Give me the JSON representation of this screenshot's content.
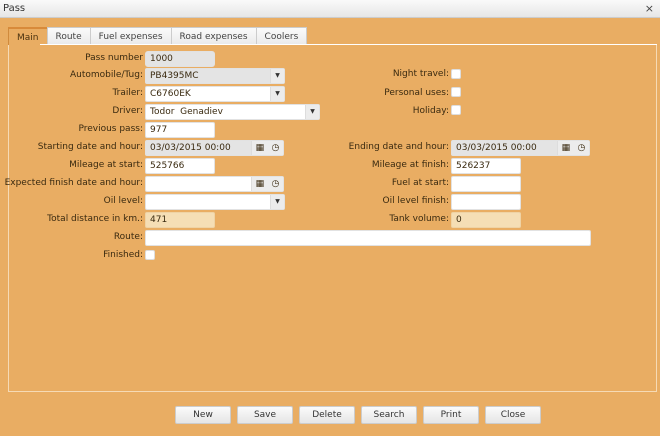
{
  "window": {
    "title": "Pass",
    "close": "×"
  },
  "tabs": [
    "Main",
    "Route",
    "Fuel expenses",
    "Road expenses",
    "Coolers"
  ],
  "left": {
    "pass_number": {
      "label": "Pass number",
      "value": "1000"
    },
    "automobile": {
      "label": "Automobile/Tug:",
      "value": "PB4395MC"
    },
    "trailer": {
      "label": "Trailer:",
      "value": "C6760EK"
    },
    "driver": {
      "label": "Driver:",
      "value": "Todor  Genadiev"
    },
    "previous_pass": {
      "label": "Previous pass:",
      "value": "977"
    },
    "starting_date": {
      "label": "Starting date and hour:",
      "value": "03/03/2015 00:00"
    },
    "mileage_start": {
      "label": "Mileage at start:",
      "value": "525766"
    },
    "expected_finish": {
      "label": "Expected finish date and hour:",
      "value": ""
    },
    "oil_level": {
      "label": "Oil level:",
      "value": ""
    },
    "total_distance": {
      "label": "Total distance in km.:",
      "value": "471"
    },
    "route": {
      "label": "Route:",
      "value": ""
    },
    "finished": {
      "label": "Finished:"
    }
  },
  "right": {
    "night_travel": {
      "label": "Night travel:"
    },
    "personal_uses": {
      "label": "Personal uses:"
    },
    "holiday": {
      "label": "Holiday:"
    },
    "ending_date": {
      "label": "Ending date and hour:",
      "value": "03/03/2015 00:00"
    },
    "mileage_finish": {
      "label": "Mileage at finish:",
      "value": "526237"
    },
    "fuel_start": {
      "label": "Fuel at start:",
      "value": ""
    },
    "oil_finish": {
      "label": "Oil level finish:",
      "value": ""
    },
    "tank_volume": {
      "label": "Tank volume:",
      "value": "0"
    }
  },
  "buttons": [
    "New",
    "Save",
    "Delete",
    "Search",
    "Print",
    "Close"
  ],
  "icons": {
    "dropdown": "▼",
    "calendar": "▦",
    "clock": "◷"
  }
}
